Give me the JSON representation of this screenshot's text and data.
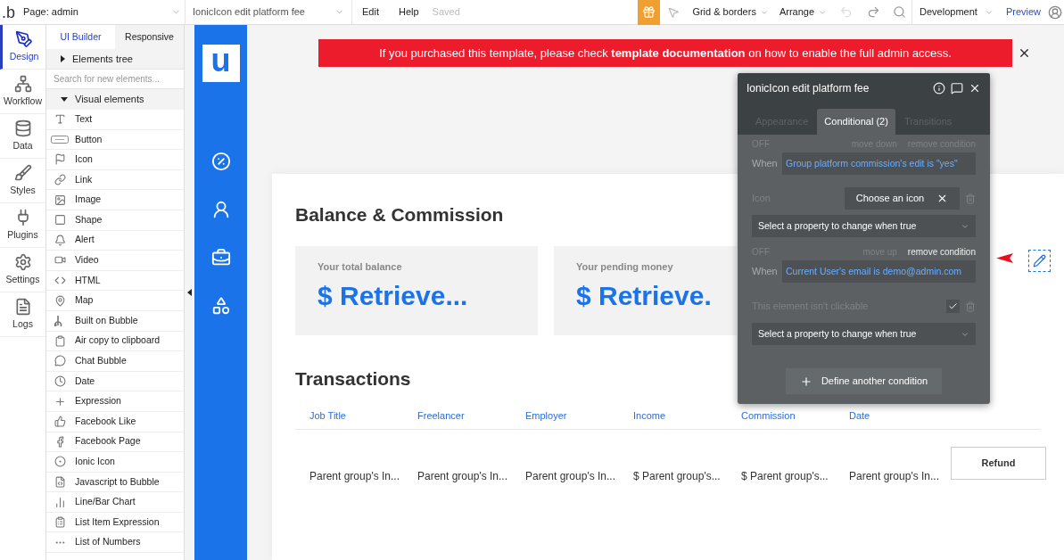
{
  "toolbar": {
    "logo": ".b",
    "page_selector": "Page: admin",
    "element_selector": "IonicIcon edit platform fee",
    "menu": [
      "Edit",
      "Help"
    ],
    "save_status": "Saved",
    "dropdowns": [
      "Grid & borders",
      "Arrange"
    ],
    "mode": "Development",
    "preview": "Preview"
  },
  "rail": [
    {
      "label": "Design",
      "selected": true
    },
    {
      "label": "Workflow",
      "selected": false
    },
    {
      "label": "Data",
      "selected": false
    },
    {
      "label": "Styles",
      "selected": false
    },
    {
      "label": "Plugins",
      "selected": false
    },
    {
      "label": "Settings",
      "selected": false
    },
    {
      "label": "Logs",
      "selected": false
    }
  ],
  "panel": {
    "tabs": [
      {
        "label": "UI Builder",
        "selected": true
      },
      {
        "label": "Responsive",
        "selected": false
      }
    ],
    "elements_tree": {
      "label": "Elements tree",
      "expanded": false
    },
    "search": {
      "placeholder": "Search for new elements..."
    },
    "visual_elements": {
      "label": "Visual elements",
      "expanded": true
    },
    "items": [
      "Text",
      "Button",
      "Icon",
      "Link",
      "Image",
      "Shape",
      "Alert",
      "Video",
      "HTML",
      "Map",
      "Built on Bubble",
      "Air copy to clipboard",
      "Chat Bubble",
      "Date",
      "Expression",
      "Facebook Like",
      "Facebook Page",
      "Ionic Icon",
      "Javascript to Bubble",
      "Line/Bar Chart",
      "List Item Expression",
      "List of Numbers"
    ]
  },
  "app": {
    "logo": "u",
    "banner": "If you purchased this template, please check **template documentation** on how to enable the full admin access.",
    "title": "Balance & Commission",
    "balances": [
      {
        "label": "Your total balance",
        "value": "$ Retrieve..."
      },
      {
        "label": "Your pending money",
        "value": "$ Retrieve."
      }
    ],
    "transactions_title": "Transactions",
    "columns": [
      "Job Title",
      "Freelancer",
      "Employer",
      "Income",
      "Commission",
      "Date"
    ],
    "rows": [
      [
        "Parent group's In...",
        "Parent group's In...",
        "Parent group's In...",
        "$ Parent group's...",
        "$ Parent group's...",
        "Parent group's In..."
      ]
    ],
    "refund_button": "Refund"
  },
  "popup": {
    "title": "IonicIcon edit platform fee",
    "tabs": [
      {
        "label": "Appearance",
        "selected": false
      },
      {
        "label": "Conditional (2)",
        "selected": true
      },
      {
        "label": "Transitions",
        "selected": false
      }
    ],
    "conditions": [
      {
        "status": "OFF",
        "move": "move down",
        "remove": "remove condition",
        "remove_hovered": false,
        "when_label": "When",
        "expression": "Group platform commission's edit is \"yes\"",
        "property": {
          "kind": "icon",
          "label": "Icon",
          "value": "Choose an icon"
        },
        "select_placeholder": "Select a property to change when true"
      },
      {
        "status": "OFF",
        "move": "move up",
        "remove": "remove condition",
        "remove_hovered": true,
        "when_label": "When",
        "expression": "Current User's email is demo@admin.com",
        "property": {
          "kind": "checkbox",
          "label": "This element isn't clickable",
          "checked": true
        },
        "select_placeholder": "Select a property to change when true"
      }
    ],
    "define_button": "Define another condition"
  }
}
